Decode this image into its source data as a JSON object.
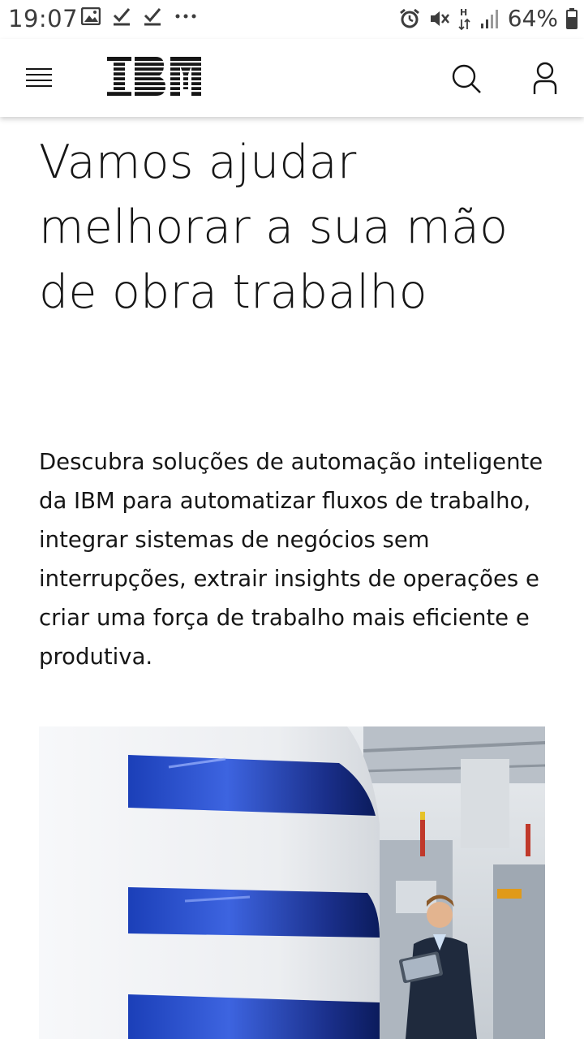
{
  "status_bar": {
    "time": "19:07",
    "battery": "64%",
    "icons_left": [
      "image-icon",
      "check-icon",
      "check-icon",
      "more-dots-icon"
    ],
    "icons_right": [
      "alarm-icon",
      "vibrate-icon",
      "network-h-icon",
      "signal-icon",
      "battery-icon"
    ]
  },
  "header": {
    "logo_text": "IBM",
    "brand_color": "#161616"
  },
  "hero": {
    "headline": "Vamos ajudar melhorar a sua mão de obra trabalho",
    "description": "Descubra soluções de automação inteligente da IBM para automatizar fluxos de trabalho, integrar sistemas de negócios sem interrupções, extrair insights de operações e criar uma força de trabalho mais eficiente e produtiva."
  }
}
